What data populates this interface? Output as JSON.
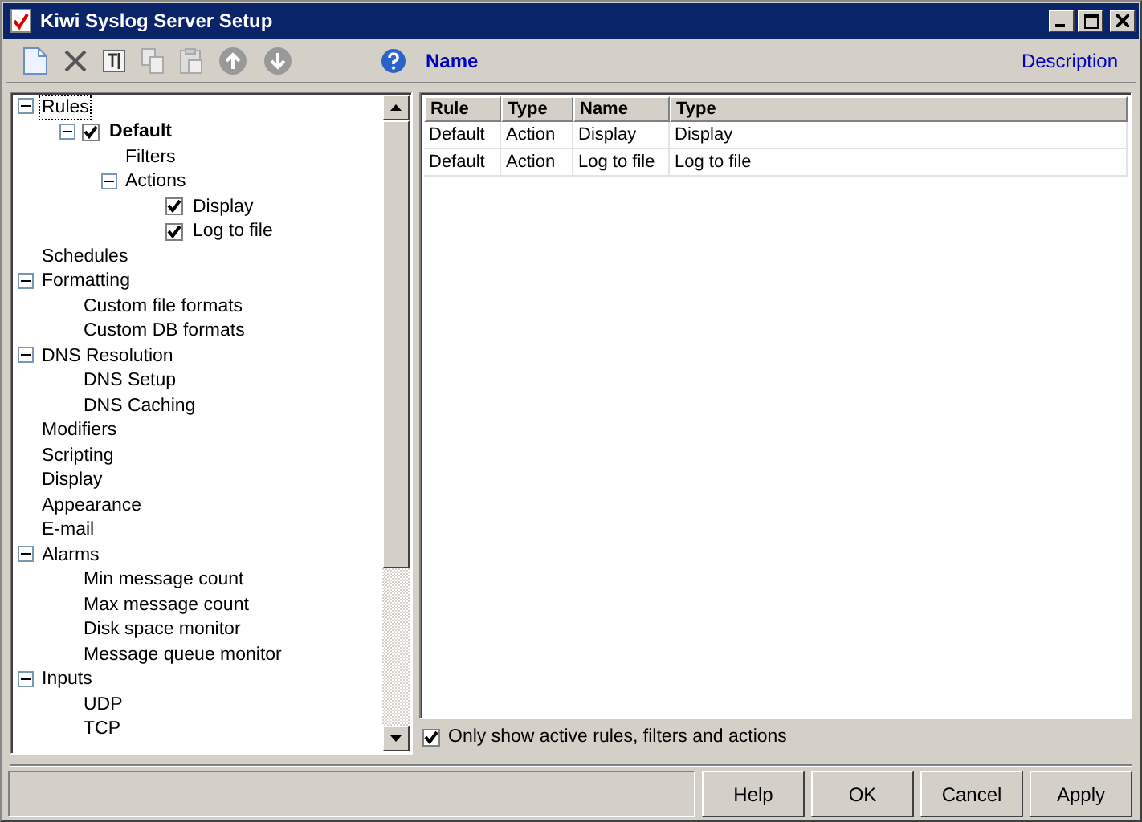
{
  "window": {
    "title": "Kiwi Syslog Server Setup"
  },
  "header": {
    "name": "Name",
    "description": "Description"
  },
  "tree": [
    {
      "label": "Rules",
      "focused": true,
      "expanded": true,
      "children": [
        {
          "label": "Default",
          "bold": true,
          "checked": true,
          "expanded": true,
          "children": [
            {
              "label": "Filters"
            },
            {
              "label": "Actions",
              "expanded": true,
              "children": [
                {
                  "label": "Display",
                  "checked": true
                },
                {
                  "label": "Log to file",
                  "checked": true
                }
              ]
            }
          ]
        }
      ]
    },
    {
      "label": "Schedules"
    },
    {
      "label": "Formatting",
      "expanded": true,
      "children": [
        {
          "label": "Custom file formats"
        },
        {
          "label": "Custom DB formats"
        }
      ]
    },
    {
      "label": "DNS Resolution",
      "expanded": true,
      "children": [
        {
          "label": "DNS Setup"
        },
        {
          "label": "DNS Caching"
        }
      ]
    },
    {
      "label": "Modifiers"
    },
    {
      "label": "Scripting"
    },
    {
      "label": "Display"
    },
    {
      "label": "Appearance"
    },
    {
      "label": "E-mail"
    },
    {
      "label": "Alarms",
      "expanded": true,
      "children": [
        {
          "label": "Min message count"
        },
        {
          "label": "Max message count"
        },
        {
          "label": "Disk space monitor"
        },
        {
          "label": "Message queue monitor"
        }
      ]
    },
    {
      "label": "Inputs",
      "expanded": true,
      "children": [
        {
          "label": "UDP"
        },
        {
          "label": "TCP"
        }
      ]
    }
  ],
  "table": {
    "columns": [
      "Rule",
      "Type",
      "Name",
      "Type"
    ],
    "rows": [
      [
        "Default",
        "Action",
        "Display",
        "Display"
      ],
      [
        "Default",
        "Action",
        "Log to file",
        "Log to file"
      ]
    ]
  },
  "only_active": {
    "label": "Only show active rules, filters and actions",
    "checked": true
  },
  "buttons": [
    "Help",
    "OK",
    "Cancel",
    "Apply"
  ]
}
